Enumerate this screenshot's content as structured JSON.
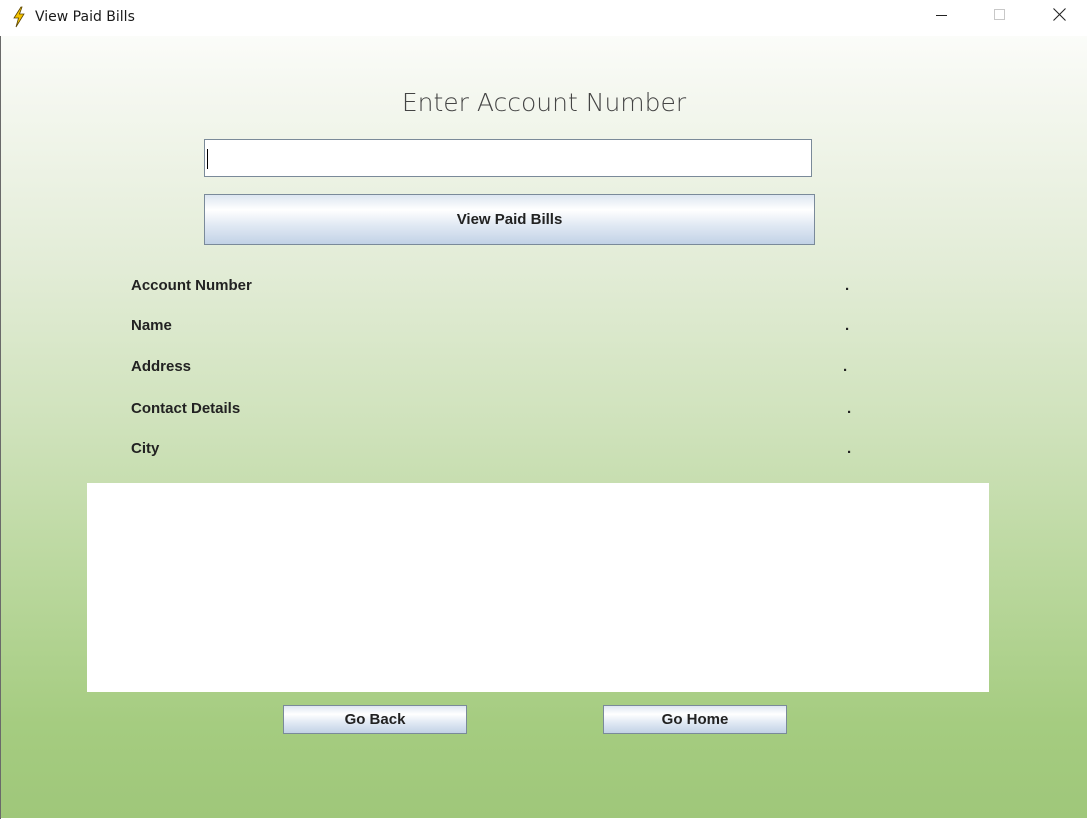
{
  "window": {
    "title": "View Paid Bills",
    "icon": "lightning-bolt-icon",
    "controls": [
      "minimize-icon",
      "maximize-icon",
      "close-icon"
    ]
  },
  "form": {
    "heading": "Enter Account Number",
    "account_input_value": "",
    "view_button_label": "View Paid Bills"
  },
  "details": [
    {
      "label": "Account Number",
      "value": "."
    },
    {
      "label": "Name",
      "value": "."
    },
    {
      "label": "Address",
      "value": "."
    },
    {
      "label": "Contact Details",
      "value": "."
    },
    {
      "label": "City",
      "value": "."
    }
  ],
  "footer": {
    "back_label": "Go Back",
    "home_label": "Go Home"
  },
  "colors": {
    "background_top": "#fbfcf9",
    "background_bottom": "#9fc77a",
    "icon_yellow": "#f5c400"
  }
}
